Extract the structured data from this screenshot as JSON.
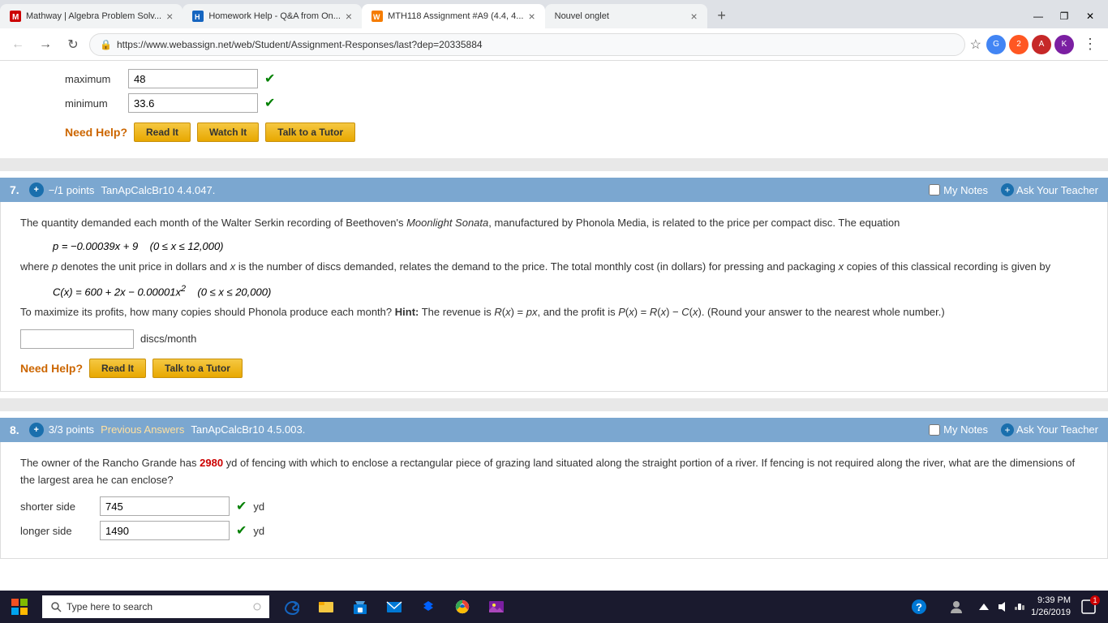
{
  "browser": {
    "tabs": [
      {
        "id": "tab1",
        "title": "Mathway | Algebra Problem Solv...",
        "favicon": "M",
        "active": false
      },
      {
        "id": "tab2",
        "title": "Homework Help - Q&A from On...",
        "favicon": "H",
        "active": false
      },
      {
        "id": "tab3",
        "title": "MTH118 Assignment #A9 (4.4, 4...",
        "favicon": "W",
        "active": true
      },
      {
        "id": "tab4",
        "title": "Nouvel onglet",
        "favicon": "",
        "active": false
      }
    ],
    "url": "https://www.webassign.net/web/Student/Assignment-Responses/last?dep=20335884"
  },
  "top_section": {
    "maximum_label": "maximum",
    "maximum_value": "48",
    "minimum_label": "minimum",
    "minimum_value": "33.6",
    "need_help_label": "Need Help?",
    "btn_read_it": "Read It",
    "btn_watch_it": "Watch It",
    "btn_talk_tutor": "Talk to a Tutor"
  },
  "question7": {
    "number": "7.",
    "points_label": "−/1 points",
    "problem_id": "TanApCalcBr10 4.4.047.",
    "my_notes_label": "My Notes",
    "ask_teacher_label": "Ask Your Teacher",
    "body_text_1": "The quantity demanded each month of the Walter Serkin recording of Beethoven's ",
    "title_italic": "Moonlight Sonata",
    "body_text_2": ", manufactured by Phonola Media, is related to the price per compact disc. The equation",
    "formula1": "p = −0.00039x + 9    (0 ≤ x ≤ 12,000)",
    "body_text_3": "where p denotes the unit price in dollars and x is the number of discs demanded, relates the demand to the price. The total monthly cost (in dollars) for pressing and packaging x copies of this classical recording is given by",
    "formula2": "C(x) = 600 + 2x − 0.00001x²    (0 ≤ x ≤ 20,000)",
    "body_text_4": "To maximize its profits, how many copies should Phonola produce each month? ",
    "hint_label": "Hint:",
    "body_text_5": " The revenue is R(x) = px, and the profit is P(x) = R(x) − C(x). (Round your answer to the nearest whole number.)",
    "answer_unit": "discs/month",
    "need_help_label": "Need Help?",
    "btn_read_it": "Read It",
    "btn_talk_tutor": "Talk to a Tutor"
  },
  "question8": {
    "number": "8.",
    "points_label": "3/3 points",
    "previous_answers": "Previous Answers",
    "problem_id": "TanApCalcBr10 4.5.003.",
    "my_notes_label": "My Notes",
    "ask_teacher_label": "Ask Your Teacher",
    "body_text": "The owner of the Rancho Grande has ",
    "highlight_value": "2980",
    "body_text_2": " yd of fencing with which to enclose a rectangular piece of grazing land situated along the straight portion of a river. If fencing is not required along the river, what are the dimensions of the largest area he can enclose?",
    "shorter_side_label": "shorter side",
    "shorter_side_value": "745",
    "shorter_side_unit": "yd",
    "longer_side_label": "longer side",
    "longer_side_value": "1490",
    "longer_side_unit": "yd"
  },
  "taskbar": {
    "search_placeholder": "Type here to search",
    "time": "9:39 PM",
    "date": "1/26/2019",
    "notification_count": "1"
  }
}
